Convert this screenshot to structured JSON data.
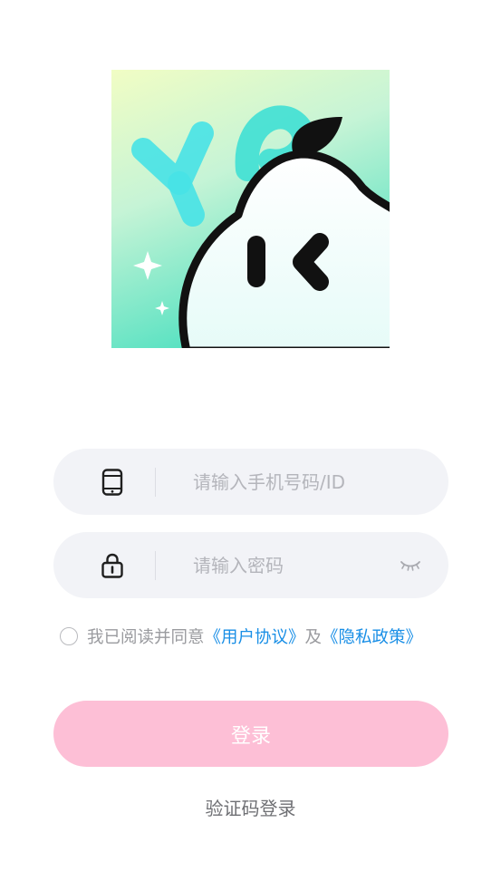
{
  "logo": {
    "icon": "pear-mascot-logo-icon",
    "colors": {
      "gradient_top": "#eefdc7",
      "gradient_bottom": "#52dfc0",
      "accent": "#3fe0e0"
    }
  },
  "phone_field": {
    "icon": "phone-icon",
    "placeholder": "请输入手机号码/ID",
    "value": ""
  },
  "password_field": {
    "icon": "lock-icon",
    "placeholder": "请输入密码",
    "value": "",
    "visibility_icon": "eye-closed-icon"
  },
  "agreement": {
    "checked": false,
    "prefix": "我已阅读并同意",
    "user_agreement": "《用户协议》",
    "conjunction": "及",
    "privacy_policy": "《隐私政策》"
  },
  "login_button": {
    "label": "登录"
  },
  "code_login": {
    "label": "验证码登录"
  },
  "colors": {
    "field_bg": "#f2f3f7",
    "login_button_bg": "#fdbfd6",
    "link": "#1a8fe6",
    "placeholder": "#b4b5bb"
  }
}
